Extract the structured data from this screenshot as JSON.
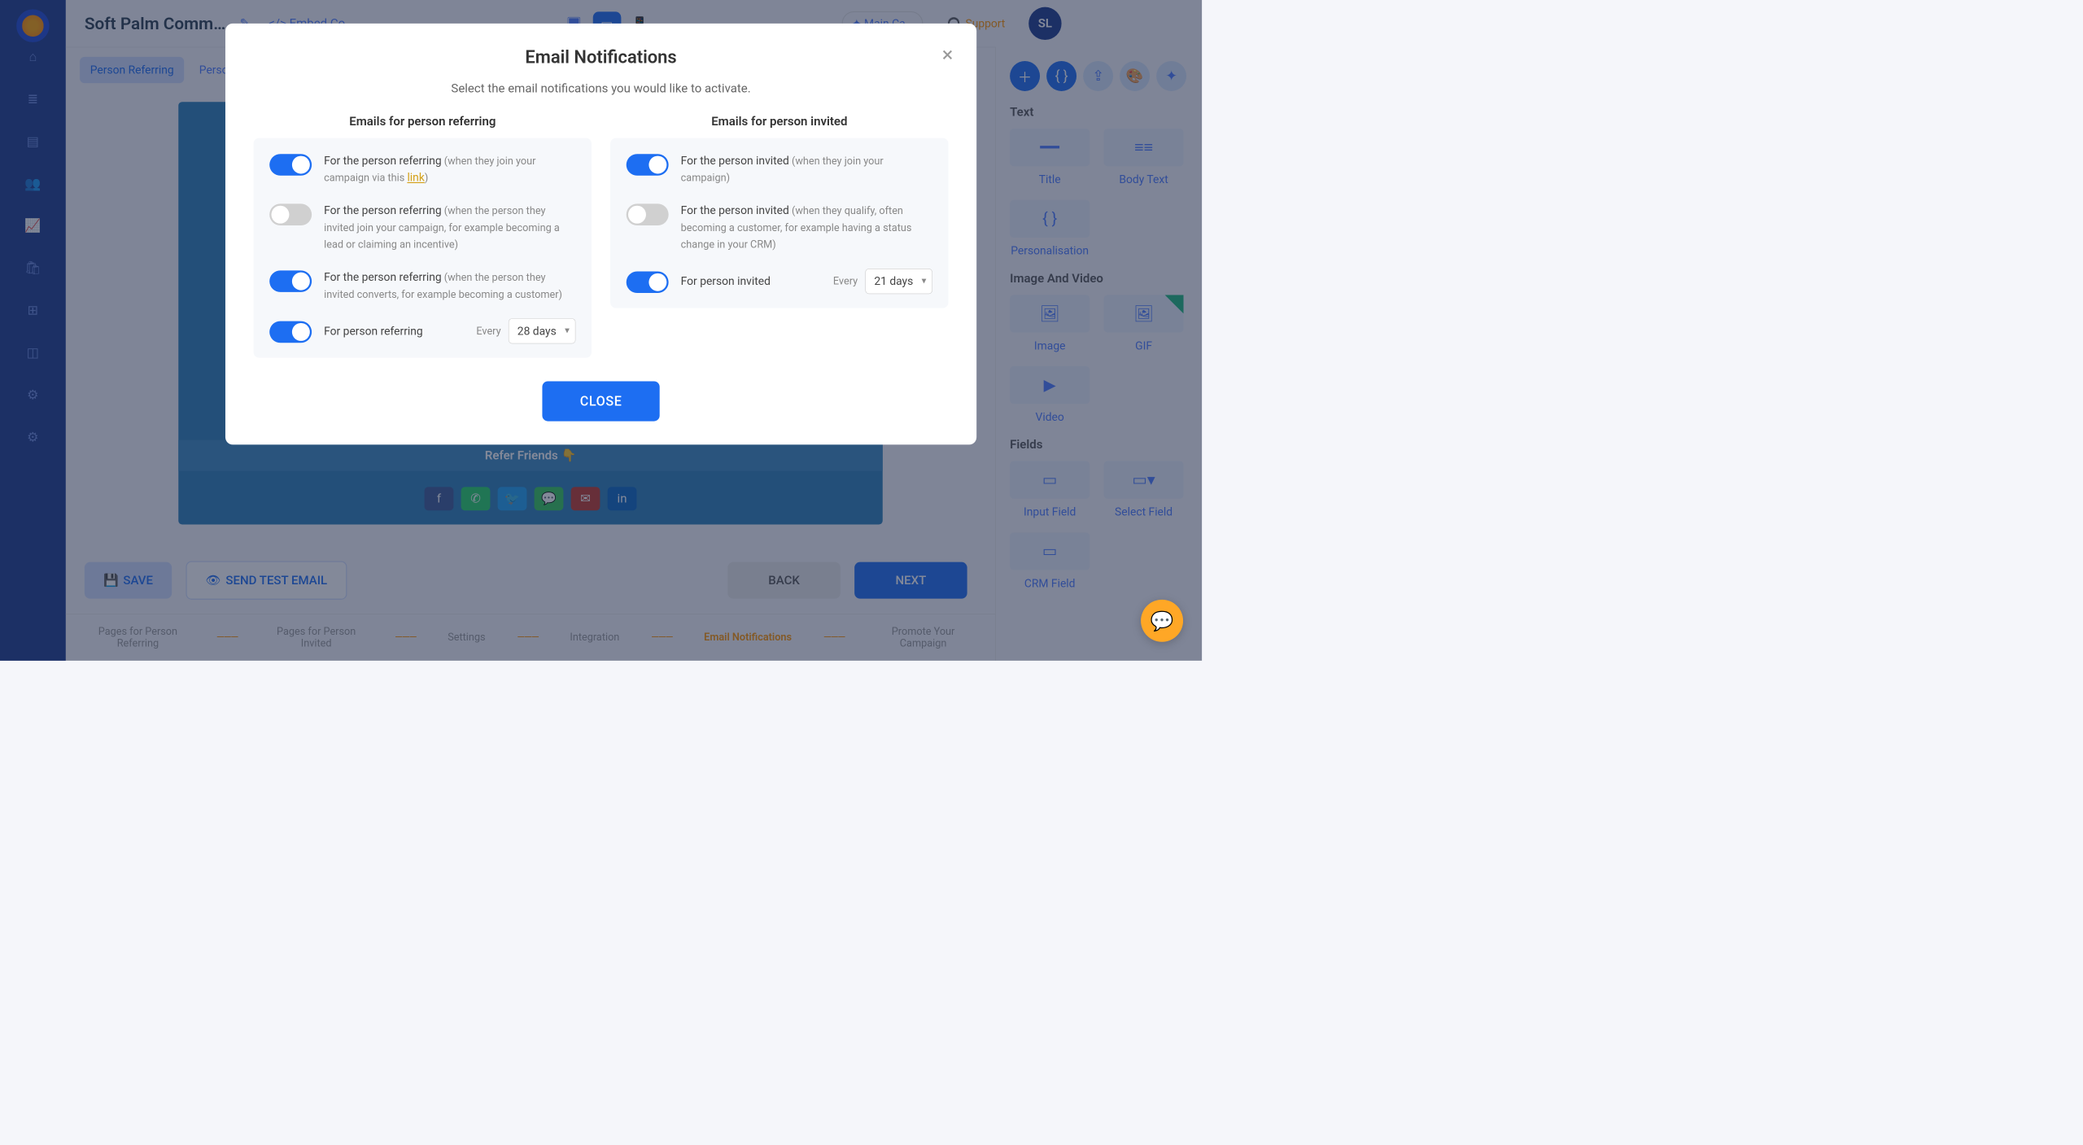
{
  "header": {
    "campaign_title": "Soft Palm Comm…",
    "code_tag": "</> Embed Co…",
    "sign_label": "✦ Main Ca…",
    "support_label": "Support",
    "avatar_initials": "SL"
  },
  "tabs": [
    "Person Referring",
    "Person…"
  ],
  "preview": {
    "banner_text": "Refer Friends 👇"
  },
  "actions": {
    "save": "SAVE",
    "send_test": "SEND TEST EMAIL",
    "back": "BACK",
    "next": "NEXT"
  },
  "steps": [
    "Pages for Person Referring",
    "Pages for Person Invited",
    "Settings",
    "Integration",
    "Email Notifications",
    "Promote Your Campaign"
  ],
  "right_panel": {
    "sections": {
      "text": "Text",
      "image": "Image And Video",
      "fields": "Fields"
    },
    "widgets": {
      "title": "Title",
      "body_text": "Body Text",
      "personalisation": "Personalisation",
      "image": "Image",
      "gif": "GIF",
      "video": "Video",
      "input_field": "Input Field",
      "select_field": "Select Field",
      "crm_field": "CRM Field"
    }
  },
  "modal": {
    "title": "Email Notifications",
    "subtitle": "Select the email notifications you would like to activate.",
    "close_button": "CLOSE",
    "left": {
      "header": "Emails for person referring",
      "items": [
        {
          "main": "For the person referring",
          "note_pre": " (when they join your campaign via this ",
          "link": "link",
          "note_post": ")"
        },
        {
          "main": "For the person referring",
          "note": " (when the person they invited join your campaign, for example becoming a lead or claiming an incentive)"
        },
        {
          "main": "For the person referring",
          "note": " (when the person they invited converts, for example becoming a customer)"
        },
        {
          "main": "For person referring",
          "every": "Every",
          "value": "28 days"
        }
      ]
    },
    "right": {
      "header": "Emails for person invited",
      "items": [
        {
          "main": "For the person invited",
          "note": " (when they join your campaign)"
        },
        {
          "main": "For the person invited",
          "note": " (when they qualify, often becoming a customer, for example having a status change in your CRM)"
        },
        {
          "main": "For person invited",
          "every": "Every",
          "value": "21 days"
        }
      ]
    }
  }
}
